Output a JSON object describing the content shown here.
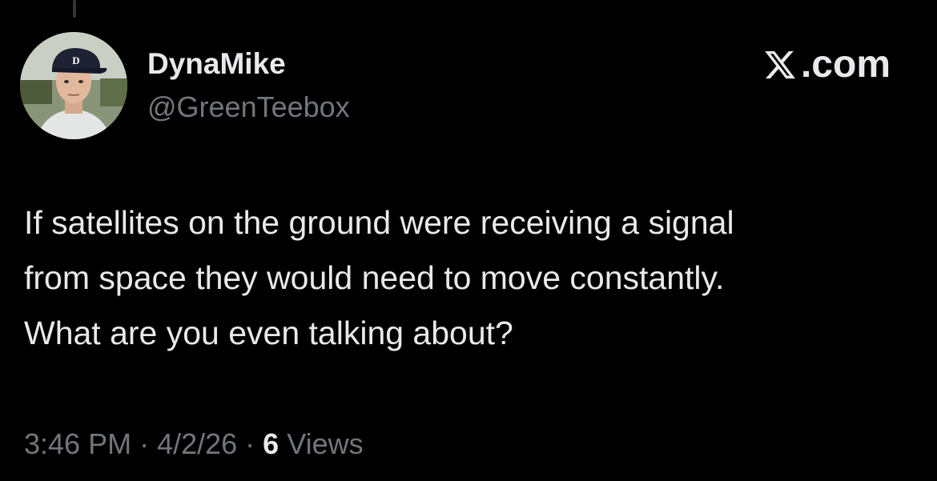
{
  "tweet": {
    "author": {
      "display_name": "DynaMike",
      "handle": "@GreenTeebox",
      "avatar_icon": "user-avatar-photo"
    },
    "brand": {
      "icon": "x-logo-icon",
      "label": ".com"
    },
    "text_lines": [
      "If satellites on the ground were receiving a signal",
      "from space they would need to move constantly.",
      "What are you even talking about?"
    ],
    "meta": {
      "time": "3:46 PM",
      "separator": "·",
      "date": "4/2/26",
      "views_count": "6",
      "views_label": "Views"
    }
  },
  "colors": {
    "background": "#000000",
    "primary_text": "#e7e9ea",
    "secondary_text": "#71767b",
    "thread_line": "#333639"
  }
}
